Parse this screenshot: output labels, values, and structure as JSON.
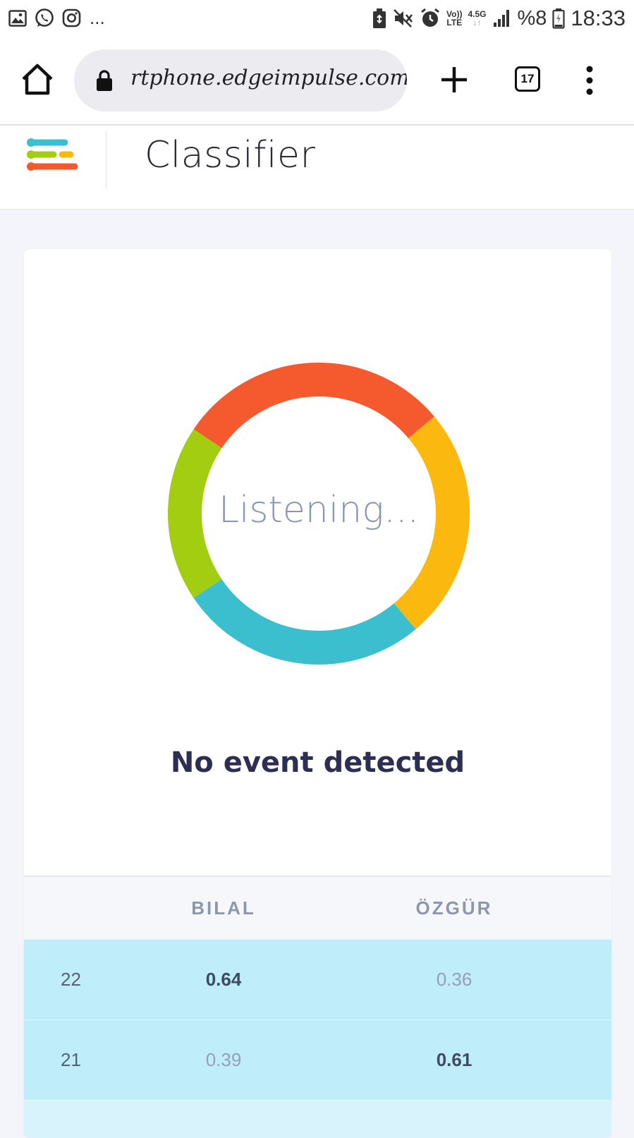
{
  "status_bar": {
    "time": "18:33",
    "battery_text": "%8",
    "network_label_top": "Vo))",
    "network_label_bottom": "LTE",
    "network_gen": "4.5G",
    "more_indicator": "...",
    "icons": [
      "image-icon",
      "whatsapp-icon",
      "instagram-icon",
      "battery-saver-icon",
      "mute-icon",
      "alarm-icon",
      "signal-icon",
      "battery-icon"
    ]
  },
  "browser": {
    "url": "rtphone.edgeimpulse.com",
    "tab_count": "17"
  },
  "app": {
    "title": "Classifier",
    "logo_colors": [
      "#3bbfce",
      "#a3cd10",
      "#fbb80f",
      "#f55a2e"
    ]
  },
  "classifier": {
    "status_text": "Listening...",
    "event_text": "No event detected",
    "ring_colors": [
      "#f55a2e",
      "#fbb80f",
      "#3bbfce",
      "#a3cd10"
    ]
  },
  "results_table": {
    "columns": [
      "",
      "BILAL",
      "ÖZGÜR"
    ],
    "rows": [
      {
        "index": "22",
        "bilal": "0.64",
        "ozgur": "0.36"
      },
      {
        "index": "21",
        "bilal": "0.39",
        "ozgur": "0.61"
      }
    ]
  }
}
